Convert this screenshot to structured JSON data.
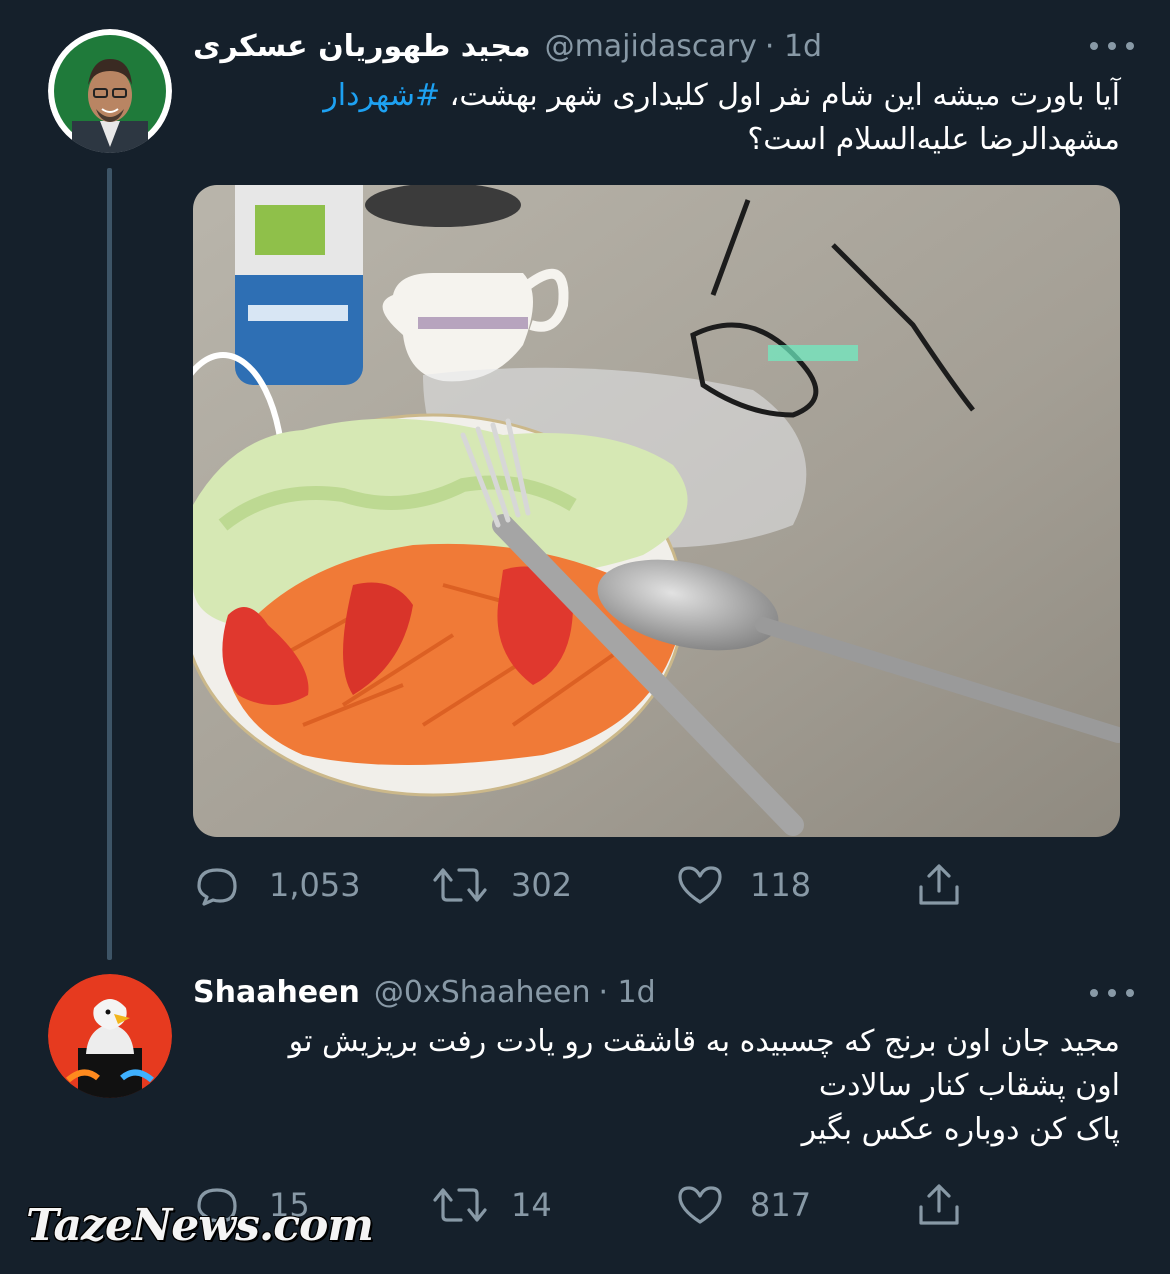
{
  "tweet": {
    "author_name": "مجید طهوریان عسکری",
    "handle": "@majidascary",
    "time": "· 1d",
    "text_line1_plain": "آیا باورت میشه این شام نفر اول کلیداری شهر بهشت، ",
    "text_line1_hashtag": "#شهردار",
    "text_line2": "مشهدالرضا علیه‌السلام است؟",
    "replies": "1,053",
    "retweets": "302",
    "likes": "118"
  },
  "reply": {
    "author_name": "Shaaheen",
    "handle": "@0xShaaheen",
    "time": "· 1d",
    "text_lines": [
      "مجید جان اون برنج که چسبیده به قاشقت رو یادت رفت بریزیش تو",
      "اون پشقاب کنار سالادت",
      "پاک کن دوباره عکس بگیر"
    ],
    "replies": "15",
    "retweets": "14",
    "likes": "817"
  },
  "icons": {
    "reply": "reply-icon",
    "retweet": "retweet-icon",
    "like": "heart-icon",
    "share": "share-icon",
    "more": "more-icon"
  },
  "colors": {
    "background": "#15202b",
    "muted": "#8899a6",
    "link": "#1da1f2",
    "thread_line": "#3d5466"
  },
  "watermark": "TazeNews.com"
}
